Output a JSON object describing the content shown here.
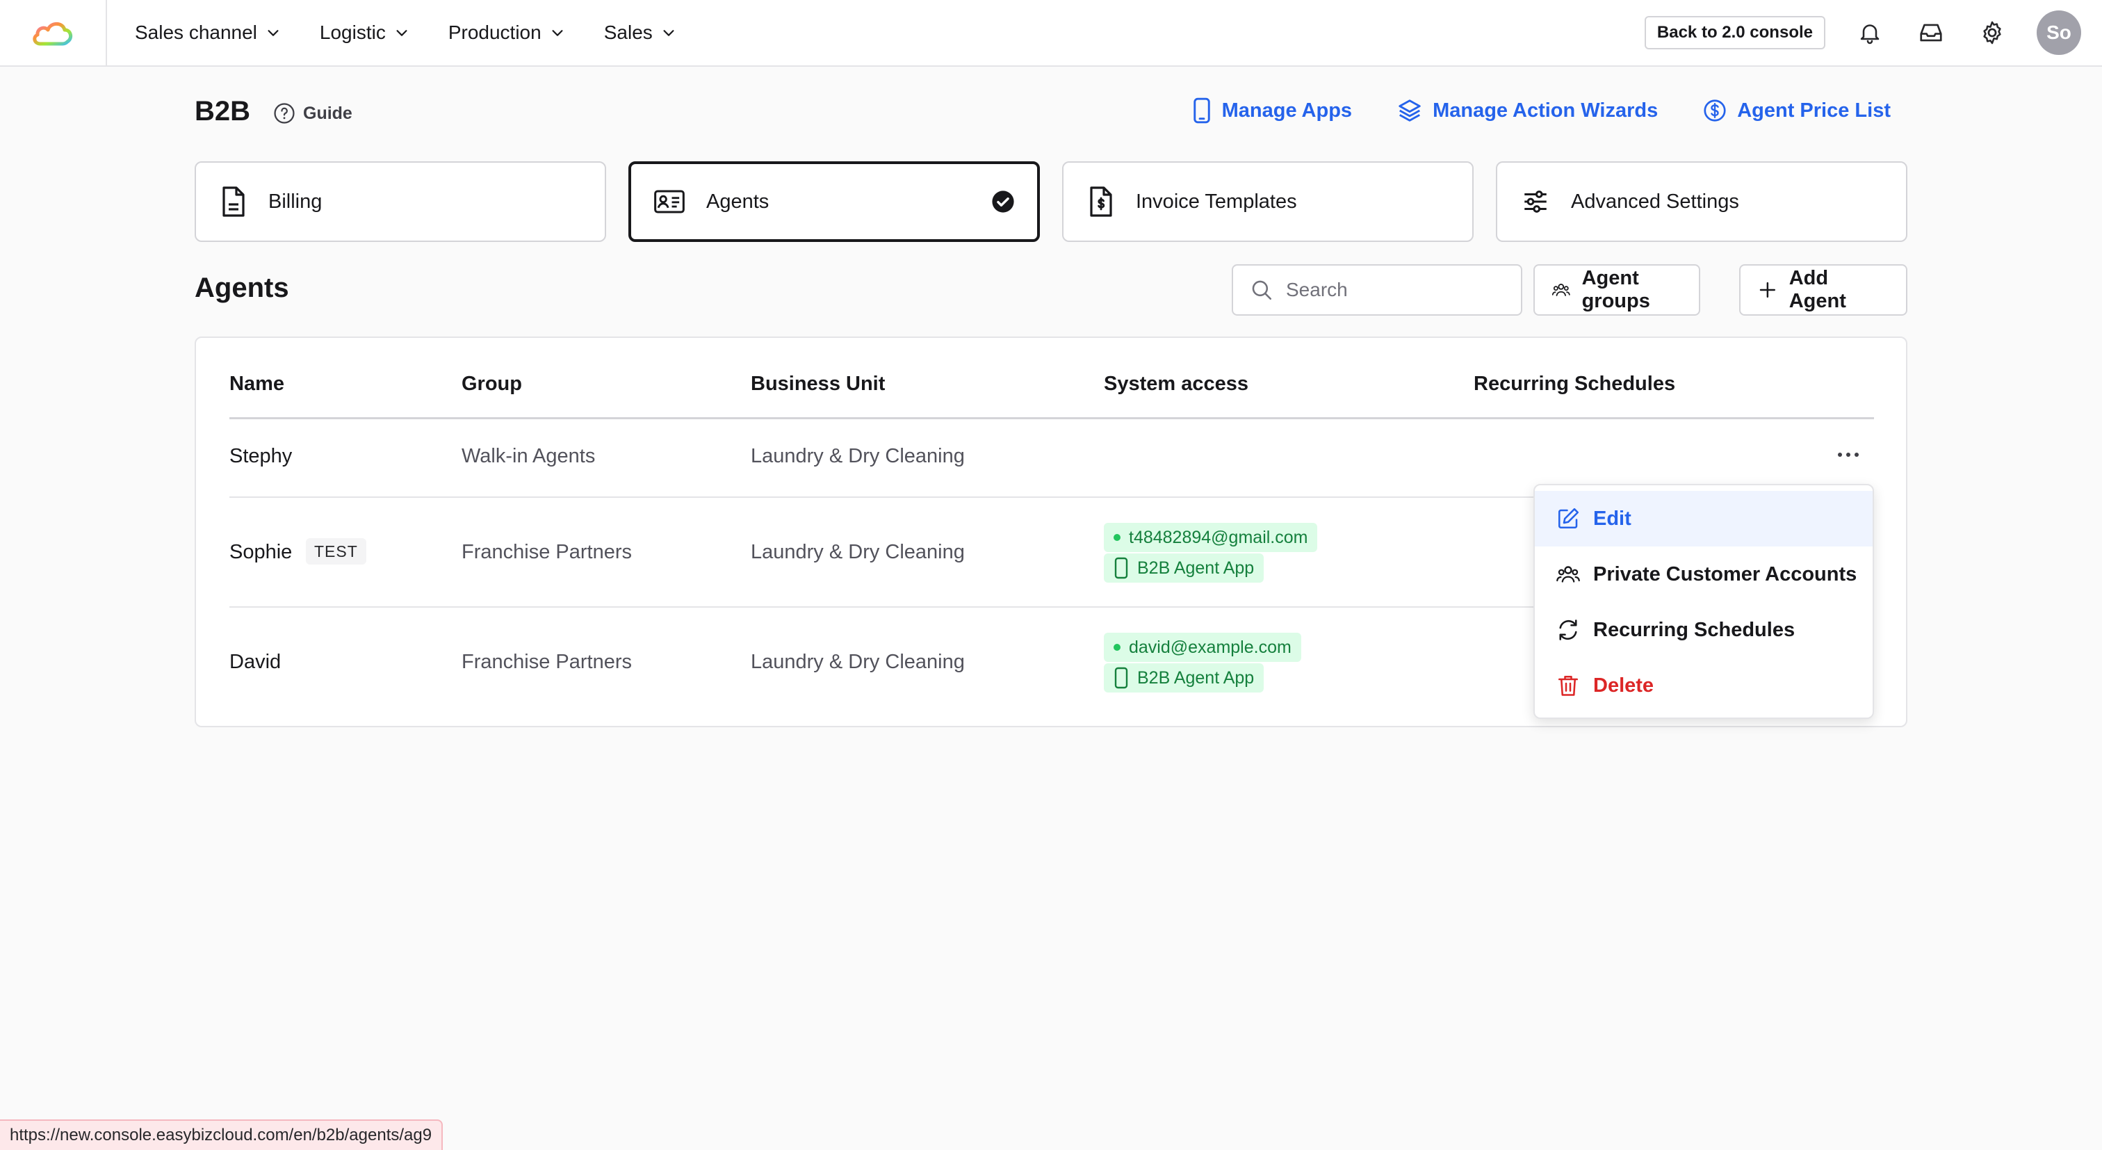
{
  "topbar": {
    "nav": [
      {
        "label": "Sales channel"
      },
      {
        "label": "Logistic"
      },
      {
        "label": "Production"
      },
      {
        "label": "Sales"
      }
    ],
    "console_button": "Back to 2.0 console",
    "avatar_initials": "So"
  },
  "header": {
    "title": "B2B",
    "guide": "Guide",
    "links": {
      "manage_apps": "Manage Apps",
      "manage_wizards": "Manage Action Wizards",
      "price_list": "Agent Price List"
    }
  },
  "cards": [
    {
      "label": "Billing",
      "active": false
    },
    {
      "label": "Agents",
      "active": true
    },
    {
      "label": "Invoice Templates",
      "active": false
    },
    {
      "label": "Advanced Settings",
      "active": false
    }
  ],
  "agents": {
    "title": "Agents",
    "search_placeholder": "Search",
    "groups_button": "Agent groups",
    "add_button": "Add Agent"
  },
  "table": {
    "headers": [
      "Name",
      "Group",
      "Business Unit",
      "System access",
      "Recurring Schedules"
    ],
    "rows": [
      {
        "name": "Stephy",
        "tag": "",
        "group": "Walk-in Agents",
        "unit": "Laundry & Dry Cleaning",
        "email": "",
        "app": ""
      },
      {
        "name": "Sophie",
        "tag": "TEST",
        "group": "Franchise Partners",
        "unit": "Laundry & Dry Cleaning",
        "email": "t48482894@gmail.com",
        "app": "B2B Agent App"
      },
      {
        "name": "David",
        "tag": "",
        "group": "Franchise Partners",
        "unit": "Laundry & Dry Cleaning",
        "email": "david@example.com",
        "app": "B2B Agent App"
      }
    ]
  },
  "menu": {
    "items": [
      {
        "label": "Edit",
        "icon": "pencil-square-icon"
      },
      {
        "label": "Private Customer Accounts",
        "icon": "users-icon"
      },
      {
        "label": "Recurring Schedules",
        "icon": "refresh-icon"
      },
      {
        "label": "Delete",
        "icon": "trash-icon"
      }
    ]
  },
  "status_url": "https://new.console.easybizcloud.com/en/b2b/agents/ag9",
  "colors": {
    "accent": "#2563eb",
    "danger": "#dc2626",
    "success_text": "#15803d",
    "success_bg": "#dcfce7"
  }
}
